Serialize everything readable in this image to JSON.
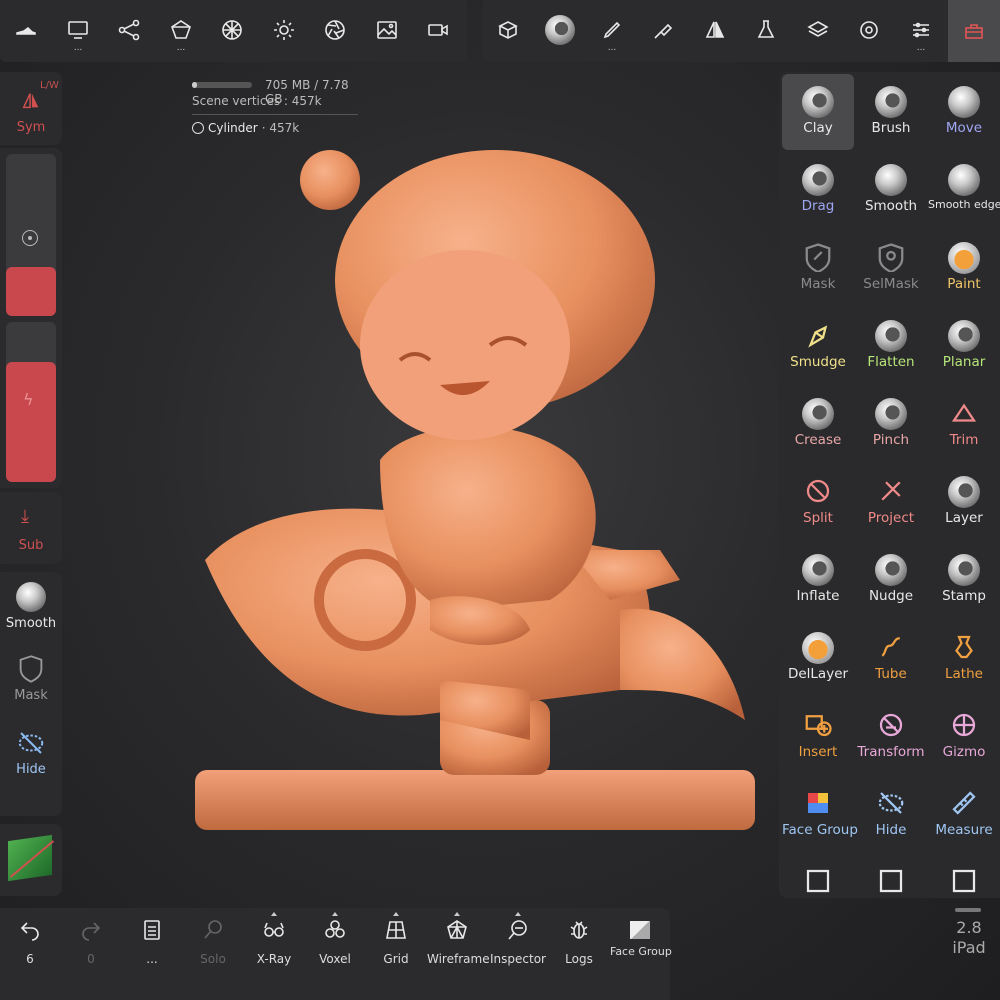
{
  "top_left_tools": [
    {
      "icon": "shoe-icon",
      "dots": ""
    },
    {
      "icon": "monitor-icon",
      "dots": "..."
    },
    {
      "icon": "scene-graph-icon",
      "dots": ""
    },
    {
      "icon": "primitive-icon",
      "dots": "..."
    },
    {
      "icon": "mesh-sphere-icon",
      "dots": ""
    },
    {
      "icon": "sun-icon",
      "dots": ""
    },
    {
      "icon": "aperture-icon",
      "dots": ""
    },
    {
      "icon": "image-icon",
      "dots": ""
    },
    {
      "icon": "video-icon",
      "dots": ""
    }
  ],
  "top_right_tools": [
    {
      "icon": "box-export-icon",
      "dots": ""
    },
    {
      "icon": "material-sphere-icon",
      "dots": ""
    },
    {
      "icon": "pen-icon",
      "dots": "..."
    },
    {
      "icon": "brush-icon",
      "dots": ""
    },
    {
      "icon": "symmetry-icon",
      "dots": ""
    },
    {
      "icon": "flask-icon",
      "dots": ""
    },
    {
      "icon": "layers-icon",
      "dots": ""
    },
    {
      "icon": "gear-icon",
      "dots": ""
    },
    {
      "icon": "sliders-icon",
      "dots": "..."
    },
    {
      "icon": "toolbox-icon",
      "dots": ""
    }
  ],
  "stats": {
    "memory": "705 MB / 7.78 GB",
    "memory_fraction": 0.09,
    "vertices": "Scene vertices : 457k",
    "object": "Cylinder",
    "object_count": "· 457k"
  },
  "left": {
    "sym_label": "Sym",
    "lw_label": "L/W",
    "sub_label": "Sub",
    "quick_tools": [
      "Smooth",
      "Mask",
      "Hide"
    ],
    "radius_fraction": 0.3,
    "intensity_fraction": 0.75
  },
  "tools": [
    {
      "label": "Clay",
      "color": "#e8e8e8",
      "icon": "sphere-dent",
      "selected": true
    },
    {
      "label": "Brush",
      "color": "#e8e8e8",
      "icon": "sphere-dent"
    },
    {
      "label": "Move",
      "color": "#9fa6f2",
      "icon": "sphere"
    },
    {
      "label": "Drag",
      "color": "#9fa6f2",
      "icon": "sphere-dent"
    },
    {
      "label": "Smooth",
      "color": "#e8e8e8",
      "icon": "sphere"
    },
    {
      "label": "Smooth edge",
      "color": "#e8e8e8",
      "icon": "sphere"
    },
    {
      "label": "Mask",
      "color": "#8a8a8a",
      "icon": "line"
    },
    {
      "label": "SelMask",
      "color": "#8a8a8a",
      "icon": "line"
    },
    {
      "label": "Paint",
      "color": "#f0c56a",
      "icon": "sphere-orange"
    },
    {
      "label": "Smudge",
      "color": "#f0e08a",
      "icon": "line"
    },
    {
      "label": "Flatten",
      "color": "#b6e57a",
      "icon": "sphere-dent"
    },
    {
      "label": "Planar",
      "color": "#b6e57a",
      "icon": "sphere-dent"
    },
    {
      "label": "Crease",
      "color": "#e8a8a8",
      "icon": "sphere-dent"
    },
    {
      "label": "Pinch",
      "color": "#e8a8a8",
      "icon": "sphere-dent"
    },
    {
      "label": "Trim",
      "color": "#f08a8a",
      "icon": "line"
    },
    {
      "label": "Split",
      "color": "#f08a8a",
      "icon": "line"
    },
    {
      "label": "Project",
      "color": "#f08a8a",
      "icon": "line"
    },
    {
      "label": "Layer",
      "color": "#e8e8e8",
      "icon": "sphere-dent"
    },
    {
      "label": "Inflate",
      "color": "#e8e8e8",
      "icon": "sphere-dent"
    },
    {
      "label": "Nudge",
      "color": "#e8e8e8",
      "icon": "sphere-dent"
    },
    {
      "label": "Stamp",
      "color": "#e8e8e8",
      "icon": "sphere-dent"
    },
    {
      "label": "DelLayer",
      "color": "#e8e8e8",
      "icon": "sphere-orange"
    },
    {
      "label": "Tube",
      "color": "#f0a040",
      "icon": "line"
    },
    {
      "label": "Lathe",
      "color": "#f0a040",
      "icon": "line"
    },
    {
      "label": "Insert",
      "color": "#f0a040",
      "icon": "line"
    },
    {
      "label": "Transform",
      "color": "#e8a8d8",
      "icon": "line"
    },
    {
      "label": "Gizmo",
      "color": "#e8a8d8",
      "icon": "line"
    },
    {
      "label": "Face Group",
      "color": "#9fc6f2",
      "icon": "line"
    },
    {
      "label": "Hide",
      "color": "#9fc6f2",
      "icon": "line"
    },
    {
      "label": "Measure",
      "color": "#9fc6f2",
      "icon": "line"
    },
    {
      "label": "",
      "color": "#e8e8e8",
      "icon": "line"
    },
    {
      "label": "",
      "color": "#e8e8e8",
      "icon": "line"
    },
    {
      "label": "",
      "color": "#e8e8e8",
      "icon": "line"
    }
  ],
  "bottom": [
    {
      "label": "6",
      "icon": "undo-icon",
      "dim": false
    },
    {
      "label": "0",
      "icon": "redo-icon",
      "dim": true
    },
    {
      "label": "...",
      "icon": "document-icon",
      "dim": false
    },
    {
      "label": "Solo",
      "icon": "search-icon",
      "dim": true
    },
    {
      "label": "X-Ray",
      "icon": "xray-glasses-icon",
      "dim": false
    },
    {
      "label": "Voxel",
      "icon": "voxel-icon",
      "dim": false
    },
    {
      "label": "Grid",
      "icon": "grid-icon",
      "dim": false
    },
    {
      "label": "Wireframe",
      "icon": "wireframe-icon",
      "dim": false
    },
    {
      "label": "Inspector",
      "icon": "inspector-icon",
      "dim": false
    },
    {
      "label": "Logs",
      "icon": "bug-icon",
      "dim": false
    },
    {
      "label": "Face Group",
      "icon": "face-group-icon",
      "dim": false
    }
  ],
  "version": {
    "number": "2.8",
    "device": "iPad"
  }
}
